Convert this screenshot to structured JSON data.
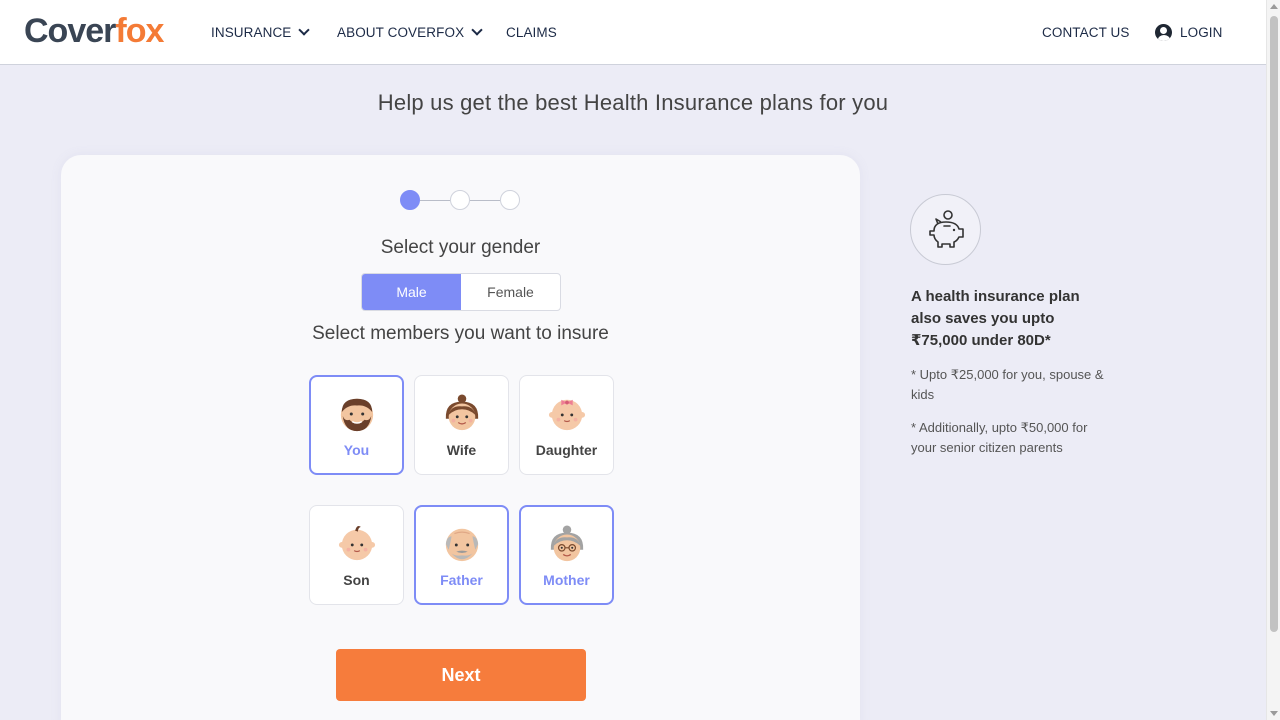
{
  "brand": {
    "logo_part1": "Cover",
    "logo_part2": "fox",
    "logo_accent": "#f47b36"
  },
  "nav": {
    "insurance": "INSURANCE",
    "about": "ABOUT COVERFOX",
    "claims": "CLAIMS",
    "contact": "CONTACT US",
    "login": "LOGIN"
  },
  "page": {
    "title": "Help us get the best Health Insurance plans for you"
  },
  "stepper": {
    "total_steps": 3,
    "current_step": 1
  },
  "gender": {
    "heading": "Select your gender",
    "options": [
      "Male",
      "Female"
    ],
    "selected": "Male"
  },
  "members": {
    "heading": "Select members you want to insure",
    "items": [
      {
        "label": "You",
        "selected": true,
        "icon": "man-face-icon"
      },
      {
        "label": "Wife",
        "selected": false,
        "icon": "woman-face-icon"
      },
      {
        "label": "Daughter",
        "selected": false,
        "icon": "baby-girl-face-icon"
      },
      {
        "label": "Son",
        "selected": false,
        "icon": "baby-boy-face-icon"
      },
      {
        "label": "Father",
        "selected": true,
        "icon": "old-man-face-icon"
      },
      {
        "label": "Mother",
        "selected": true,
        "icon": "old-woman-face-icon"
      }
    ]
  },
  "actions": {
    "next_label": "Next"
  },
  "side": {
    "heading_line1": "A health insurance plan",
    "heading_line2": "also saves you upto",
    "heading_line3": "₹75,000 under 80D*",
    "note1": "* Upto ₹25,000 for you, spouse & kids",
    "note2": "* Additionally, upto ₹50,000 for your senior citizen parents",
    "icon": "piggy-bank-icon"
  },
  "colors": {
    "primary": "#7e8cf6",
    "cta": "#f67c3c",
    "background": "#ececf6"
  }
}
